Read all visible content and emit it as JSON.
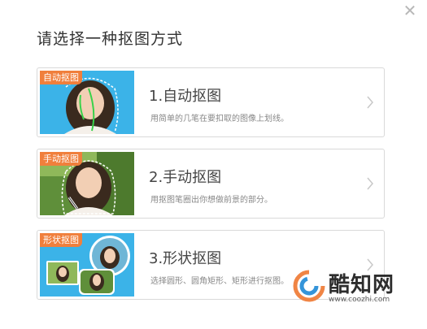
{
  "dialog": {
    "title": "请选择一种抠图方式",
    "close_icon": "close-icon"
  },
  "options": [
    {
      "tag": "自动抠图",
      "title": "1.自动抠图",
      "desc": "用简单的几笔在要扣取的图像上划线。"
    },
    {
      "tag": "手动抠图",
      "title": "2.手动抠图",
      "desc": "用抠图笔圈出你想做前景的部分。"
    },
    {
      "tag": "形状抠图",
      "title": "3.形状抠图",
      "desc": "选择圆形、圆角矩形、矩形进行抠图。"
    }
  ],
  "watermark": {
    "name": "酷知网",
    "url": "www.coozhi.com"
  },
  "colors": {
    "tag_orange": "#f07f3c",
    "thumb_blue": "#3bb3e8",
    "border": "#d9d9d9"
  }
}
